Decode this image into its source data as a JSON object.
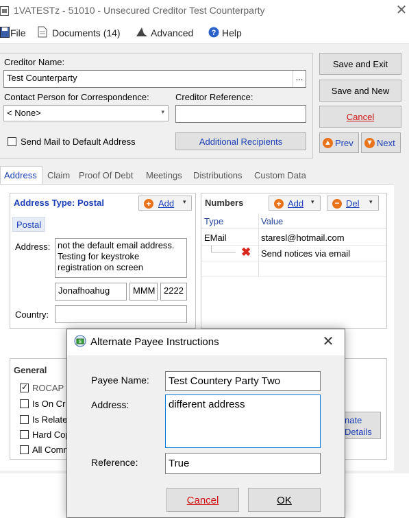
{
  "window": {
    "title": "1VATESTz - 51010 - Unsecured Creditor Test Counterparty"
  },
  "menu": [
    {
      "label": "File",
      "icon": "save-icon"
    },
    {
      "label": "Documents (14)",
      "icon": "document-icon"
    },
    {
      "label": "Advanced",
      "icon": "wizard-hat-icon"
    },
    {
      "label": "Help",
      "icon": "help-icon"
    }
  ],
  "form": {
    "creditor_name_label": "Creditor Name:",
    "creditor_name_value": "Test Counterparty",
    "ellipsis": "...",
    "contact_label": "Contact Person for Correspondence:",
    "contact_value": "< None>",
    "creditor_ref_label": "Creditor Reference:",
    "creditor_ref_value": "",
    "send_mail_label": "Send Mail to Default Address",
    "send_mail_checked": false,
    "additional_recipients": "Additional Recipients"
  },
  "actions": {
    "save_exit": "Save and Exit",
    "save_new": "Save and New",
    "cancel": "Cancel",
    "prev": "Prev",
    "next": "Next"
  },
  "tabs": [
    "Address",
    "Claim",
    "Proof Of Debt",
    "Meetings",
    "Distributions",
    "Custom Data"
  ],
  "active_tab": "Address",
  "address": {
    "type_label": "Address Type: Postal",
    "add": "Add",
    "postal_item": "Postal",
    "address_label": "Address:",
    "address_lines": [
      "not the default email address.",
      "Testing for keystroke",
      "registration on screen"
    ],
    "city": "Jonafhoahug",
    "state": "MMM",
    "postcode": "2222",
    "country_label": "Country:",
    "country_value": ""
  },
  "numbers": {
    "title": "Numbers",
    "add": "Add",
    "del": "Del",
    "headers": [
      "Type",
      "Value"
    ],
    "rows": [
      {
        "type": "EMail",
        "value": "staresl@hotmail.com"
      },
      {
        "type": "",
        "value": "Send notices via email"
      }
    ]
  },
  "general": {
    "title": "General",
    "items": [
      {
        "label": "ROCAP C",
        "checked": true
      },
      {
        "label": "Is On Cr",
        "checked": false
      },
      {
        "label": "Is Relate",
        "checked": false
      },
      {
        "label": "Hard Cop",
        "checked": false
      },
      {
        "label": "All Comm",
        "checked": false
      }
    ],
    "alt_button_lines": [
      "nate",
      "Details"
    ]
  },
  "dialog": {
    "title": "Alternate Payee Instructions",
    "payee_name_label": "Payee Name:",
    "payee_name_value": "Test Countery Party Two",
    "address_label": "Address:",
    "address_value": "different address",
    "reference_label": "Reference:",
    "reference_value": "True",
    "cancel": "Cancel",
    "ok": "OK"
  },
  "colors": {
    "accent_blue": "#1a3fb8",
    "cancel_red": "#d01010",
    "icon_orange": "#e8731a"
  }
}
